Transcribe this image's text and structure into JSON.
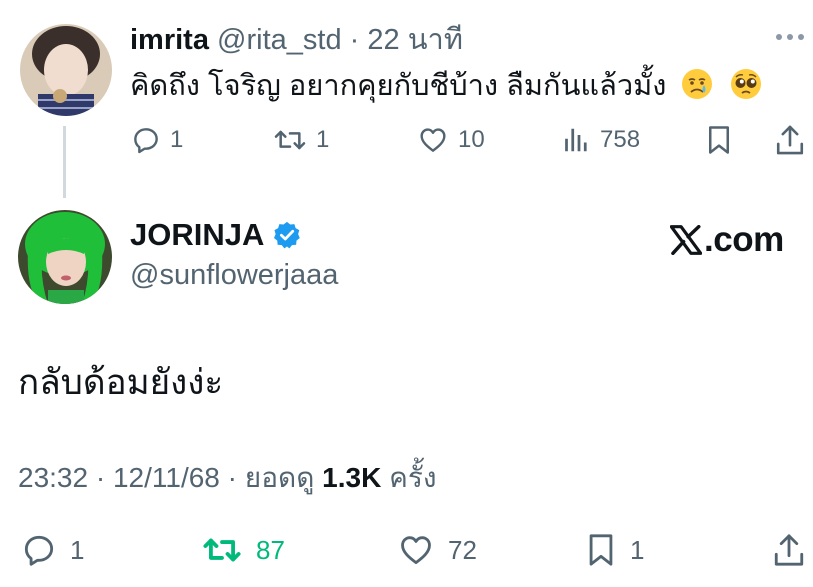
{
  "reply": {
    "display_name": "imrita",
    "handle": "@rita_std",
    "separator": "·",
    "time": "22 นาที",
    "text": "คิดถึง โจริญ อยากคุยกับชีบ้าง ลืมกันแล้วมั้ง",
    "emojis": [
      "crying-face",
      "pleading-face"
    ],
    "actions": {
      "replies": "1",
      "reposts": "1",
      "likes": "10",
      "views": "758"
    },
    "more_icon": "ellipsis-icon"
  },
  "main": {
    "display_name": "JORINJA",
    "verified": true,
    "handle": "@sunflowerjaaa",
    "brand": "X",
    "brand_suffix": ".com",
    "text": "กลับด้อมยังง่ะ",
    "meta": {
      "time": "23:32",
      "sep1": "·",
      "date": "12/11/68",
      "sep2": "·",
      "views_label": "ยอดดู",
      "views_value": "1.3K",
      "views_unit": "ครั้ง"
    },
    "actions": {
      "replies": "1",
      "reposts": "87",
      "likes": "72",
      "bookmarks": "1"
    }
  },
  "colors": {
    "text": "#0f1419",
    "muted": "#536471",
    "verified": "#1d9bf0",
    "repost_active": "#00ba7c",
    "thread_line": "#cfd9de"
  }
}
